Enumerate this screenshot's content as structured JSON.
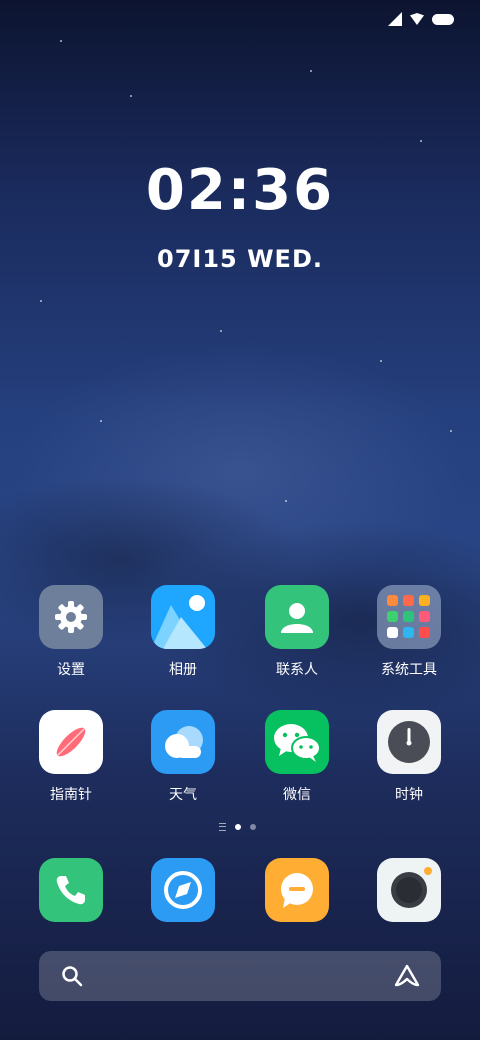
{
  "status_bar": {
    "icons": [
      "signal-icon",
      "wifi-icon",
      "battery-icon"
    ]
  },
  "clock": {
    "time": "02:36"
  },
  "date": {
    "text": "07I15 WED."
  },
  "apps": [
    {
      "label": "设置",
      "icon": "settings-icon",
      "color": "#6e7f9b"
    },
    {
      "label": "相册",
      "icon": "gallery-icon",
      "color": "#1fa6ff"
    },
    {
      "label": "联系人",
      "icon": "contacts-icon",
      "color": "#33c37a"
    },
    {
      "label": "系统工具",
      "icon": "folder-icon",
      "color": "#8b99b8"
    },
    {
      "label": "指南针",
      "icon": "compass-icon",
      "color": "#ffffff"
    },
    {
      "label": "天气",
      "icon": "weather-icon",
      "color": "#2b9bf4"
    },
    {
      "label": "微信",
      "icon": "wechat-icon",
      "color": "#07c160"
    },
    {
      "label": "时钟",
      "icon": "clock-icon",
      "color": "#f2f3f5"
    }
  ],
  "page_indicator": {
    "pages": 2,
    "current": 1
  },
  "dock": [
    {
      "icon": "phone-icon",
      "color": "#33c37a"
    },
    {
      "icon": "browser-icon",
      "color": "#2b9bf4"
    },
    {
      "icon": "messages-icon",
      "color": "#ffad33"
    },
    {
      "icon": "camera-icon",
      "color": "#eef3f3"
    }
  ],
  "search": {
    "icon": "search-icon",
    "assistant_icon": "assistant-icon"
  }
}
